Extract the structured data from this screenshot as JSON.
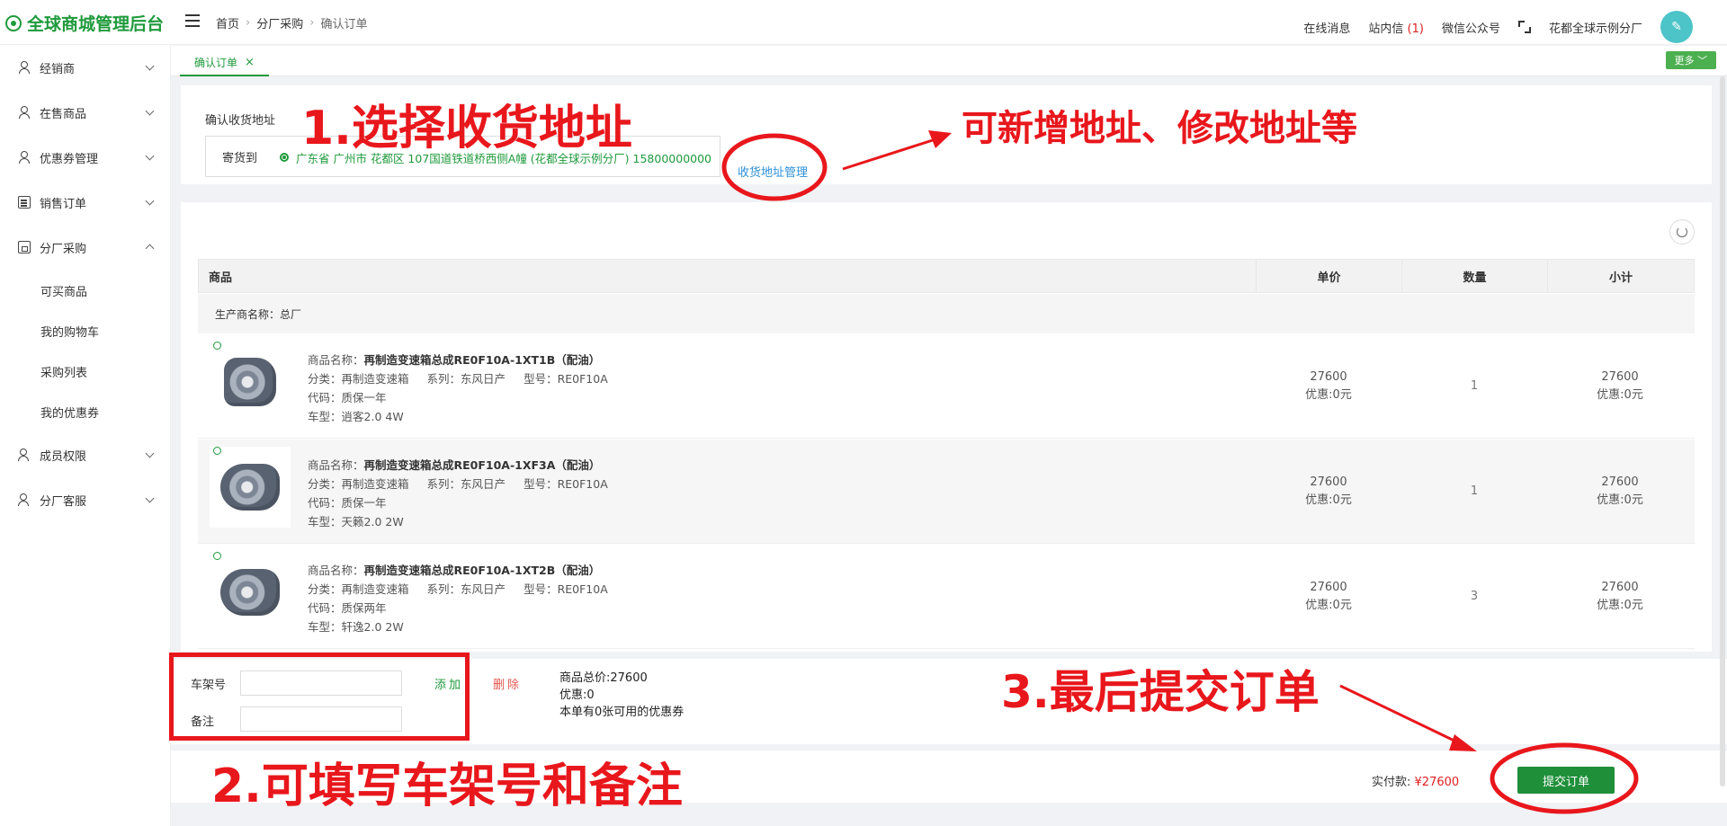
{
  "app": {
    "title": "全球商城管理后台"
  },
  "breadcrumb": [
    "首页",
    "分厂采购",
    "确认订单"
  ],
  "header": {
    "online_msg": "在线消息",
    "site_msg": "站内信",
    "site_msg_count": "(1)",
    "wechat": "微信公众号",
    "user_name": "花都全球示例分厂"
  },
  "sidebar": {
    "items": [
      {
        "label": "经销商",
        "icon": "user-icon",
        "expanded": false
      },
      {
        "label": "在售商品",
        "icon": "user-icon",
        "expanded": false
      },
      {
        "label": "优惠券管理",
        "icon": "user-icon",
        "expanded": false
      },
      {
        "label": "销售订单",
        "icon": "document-icon",
        "expanded": false
      },
      {
        "label": "分厂采购",
        "icon": "shop-icon",
        "expanded": true
      },
      {
        "label": "成员权限",
        "icon": "users-icon",
        "expanded": false
      },
      {
        "label": "分厂客服",
        "icon": "users-icon",
        "expanded": false
      }
    ],
    "sub_items": [
      "可买商品",
      "我的购物车",
      "采购列表",
      "我的优惠券"
    ]
  },
  "tabs": {
    "active": "确认订单",
    "close": "×",
    "more": "更多 ﹀"
  },
  "address": {
    "title": "确认收货地址",
    "ship_to": "寄货到",
    "selected": "广东省 广州市 花都区 107国道铁道桥西侧A幢 (花都全球示例分厂) 15800000000",
    "manage": "收货地址管理"
  },
  "table": {
    "headers": {
      "goods": "商品",
      "price": "单价",
      "qty": "数量",
      "subtotal": "小计"
    },
    "maker": "生产商名称：总厂",
    "rows": [
      {
        "name_label": "商品名称：",
        "name": "再制造变速箱总成RE0F10A-1XT1B（配油）",
        "category_label": "分类：",
        "category": "再制造变速箱",
        "series_label": "系列：",
        "series": "东风日产",
        "model_label": "型号：",
        "model": "RE0F10A",
        "code_label": "代码：",
        "code": "质保一年",
        "car_label": "车型：",
        "car": "逍客2.0 4W",
        "price": "27600",
        "discount": "优惠:0元",
        "qty": "1",
        "subtotal": "27600",
        "subtotal_discount": "优惠:0元"
      },
      {
        "name_label": "商品名称：",
        "name": "再制造变速箱总成RE0F10A-1XF3A（配油）",
        "category_label": "分类：",
        "category": "再制造变速箱",
        "series_label": "系列：",
        "series": "东风日产",
        "model_label": "型号：",
        "model": "RE0F10A",
        "code_label": "代码：",
        "code": "质保一年",
        "car_label": "车型：",
        "car": "天籁2.0 2W",
        "price": "27600",
        "discount": "优惠:0元",
        "qty": "1",
        "subtotal": "27600",
        "subtotal_discount": "优惠:0元"
      },
      {
        "name_label": "商品名称：",
        "name": "再制造变速箱总成RE0F10A-1XT2B（配油）",
        "category_label": "分类：",
        "category": "再制造变速箱",
        "series_label": "系列：",
        "series": "东风日产",
        "model_label": "型号：",
        "model": "RE0F10A",
        "code_label": "代码：",
        "code": "质保两年",
        "car_label": "车型：",
        "car": "轩逸2.0 2W",
        "price": "27600",
        "discount": "优惠:0元",
        "qty": "3",
        "subtotal": "27600",
        "subtotal_discount": "优惠:0元"
      }
    ]
  },
  "form": {
    "frame_label": "车架号",
    "remark_label": "备注",
    "frame_value": "",
    "remark_value": "",
    "add": "添加",
    "delete": "删除"
  },
  "summary": {
    "total": "商品总价:27600",
    "discount": "优惠:0",
    "coupons": "本单有0张可用的优惠券"
  },
  "payment": {
    "label": "实付款:",
    "amount": "¥27600",
    "submit": "提交订单"
  },
  "annotations": {
    "step1": "1.选择收货地址",
    "step1_note": "可新增地址、修改地址等",
    "step2": "2.可填写车架号和备注",
    "step3": "3.最后提交订单",
    "color": "#e8171c"
  },
  "colors": {
    "brand_green": "#1f9a3c",
    "link_blue": "#2c8fd6",
    "price_red": "#e02020"
  }
}
